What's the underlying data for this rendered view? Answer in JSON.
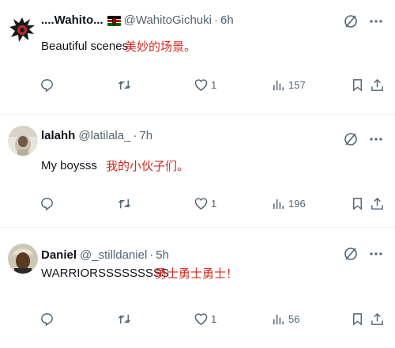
{
  "replies": [
    {
      "name": "....Wahito...",
      "handle": "@WahitoGichuki",
      "separator": "·",
      "time": "6h",
      "text": "Beautiful scenes",
      "translation": "美妙的场景。",
      "stats": {
        "reply": "",
        "repost": "",
        "like": "1",
        "views": "157"
      },
      "colors": {
        "avatar_bg": "#1a1a1a",
        "avatar_accent": "#c62828"
      }
    },
    {
      "name": "lalahh",
      "handle": "@latilala_",
      "separator": "·",
      "time": "7h",
      "text": "My boysss",
      "translation": "我的小伙子们。",
      "stats": {
        "reply": "",
        "repost": "",
        "like": "1",
        "views": "196"
      },
      "colors": {
        "avatar_bg": "#d9d2c8",
        "avatar_accent": "#6b5a4a"
      }
    },
    {
      "name": "Daniel",
      "handle": "@_stilldaniel",
      "separator": "·",
      "time": "5h",
      "text": "WARRIORSSSSSSSSS",
      "translation": "勇士勇士勇士！",
      "stats": {
        "reply": "",
        "repost": "",
        "like": "1",
        "views": "56"
      },
      "colors": {
        "avatar_bg": "#cfc7b6",
        "avatar_accent": "#5b3a24"
      }
    }
  ],
  "icons": {
    "reply": "reply-icon",
    "repost": "repost-icon",
    "like": "heart-icon",
    "views": "views-icon",
    "bookmark": "bookmark-icon",
    "share": "share-icon",
    "grok": "grok-icon",
    "more": "more-icon"
  },
  "colors": {
    "text": "#0f1419",
    "muted": "#536471",
    "translation": "#d9281c",
    "divider": "#eff3f4"
  }
}
